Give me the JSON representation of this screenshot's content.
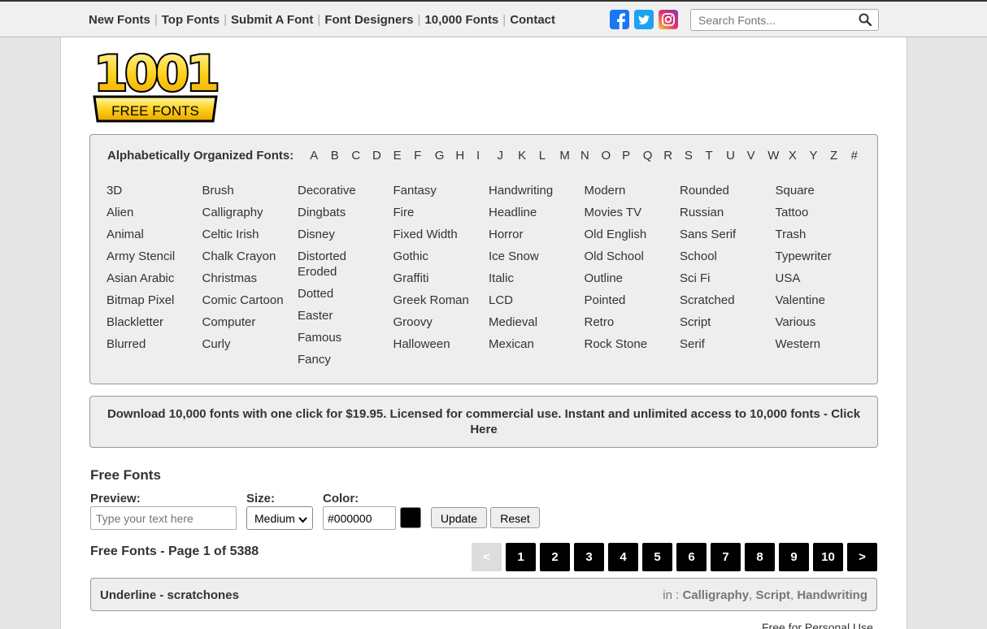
{
  "nav": {
    "links": [
      "New Fonts",
      "Top Fonts",
      "Submit A Font",
      "Font Designers",
      "10,000 Fonts",
      "Contact"
    ],
    "sep": "|"
  },
  "social": {
    "facebook": "facebook-icon",
    "twitter": "twitter-icon",
    "instagram": "instagram-icon"
  },
  "search": {
    "placeholder": "Search Fonts..."
  },
  "logo": {
    "top_text": "1001",
    "bottom_text": "FREE FONTS"
  },
  "alphabet": {
    "label": "Alphabetically Organized Fonts:",
    "letters": [
      "A",
      "B",
      "C",
      "D",
      "E",
      "F",
      "G",
      "H",
      "I",
      "J",
      "K",
      "L",
      "M",
      "N",
      "O",
      "P",
      "Q",
      "R",
      "S",
      "T",
      "U",
      "V",
      "W",
      "X",
      "Y",
      "Z",
      "#"
    ]
  },
  "categories": [
    [
      "3D",
      "Alien",
      "Animal",
      "Army Stencil",
      "Asian Arabic",
      "Bitmap Pixel",
      "Blackletter",
      "Blurred"
    ],
    [
      "Brush",
      "Calligraphy",
      "Celtic Irish",
      "Chalk Crayon",
      "Christmas",
      "Comic Cartoon",
      "Computer",
      "Curly"
    ],
    [
      "Decorative",
      "Dingbats",
      "Disney",
      "Distorted Eroded",
      "Dotted",
      "Easter",
      "Famous",
      "Fancy"
    ],
    [
      "Fantasy",
      "Fire",
      "Fixed Width",
      "Gothic",
      "Graffiti",
      "Greek Roman",
      "Groovy",
      "Halloween"
    ],
    [
      "Handwriting",
      "Headline",
      "Horror",
      "Ice Snow",
      "Italic",
      "LCD",
      "Medieval",
      "Mexican"
    ],
    [
      "Modern",
      "Movies TV",
      "Old English",
      "Old School",
      "Outline",
      "Pointed",
      "Retro",
      "Rock Stone"
    ],
    [
      "Rounded",
      "Russian",
      "Sans Serif",
      "School",
      "Sci Fi",
      "Scratched",
      "Script",
      "Serif"
    ],
    [
      "Square",
      "Tattoo",
      "Trash",
      "Typewriter",
      "USA",
      "Valentine",
      "Various",
      "Western"
    ]
  ],
  "promo": {
    "text": "Download 10,000 fonts with one click for $19.95. Licensed for commercial use. Instant and unlimited access to 10,000 fonts - Click Here"
  },
  "controls": {
    "section_title": "Free Fonts",
    "preview_label": "Preview:",
    "preview_placeholder": "Type your text here",
    "size_label": "Size:",
    "size_value": "Medium",
    "color_label": "Color:",
    "color_value": "#000000",
    "swatch_color": "#000000",
    "update_label": "Update",
    "reset_label": "Reset"
  },
  "pagination": {
    "label": "Free Fonts - Page 1 of 5388",
    "prev": "<",
    "pages": [
      "1",
      "2",
      "3",
      "4",
      "5",
      "6",
      "7",
      "8",
      "9",
      "10"
    ],
    "next": ">"
  },
  "font_entry": {
    "name": "Underline",
    "dash": " - ",
    "author": "scratchones",
    "in_label": "in : ",
    "categories": [
      "Calligraphy",
      "Script",
      "Handwriting"
    ],
    "license": "Free for Personal Use"
  }
}
